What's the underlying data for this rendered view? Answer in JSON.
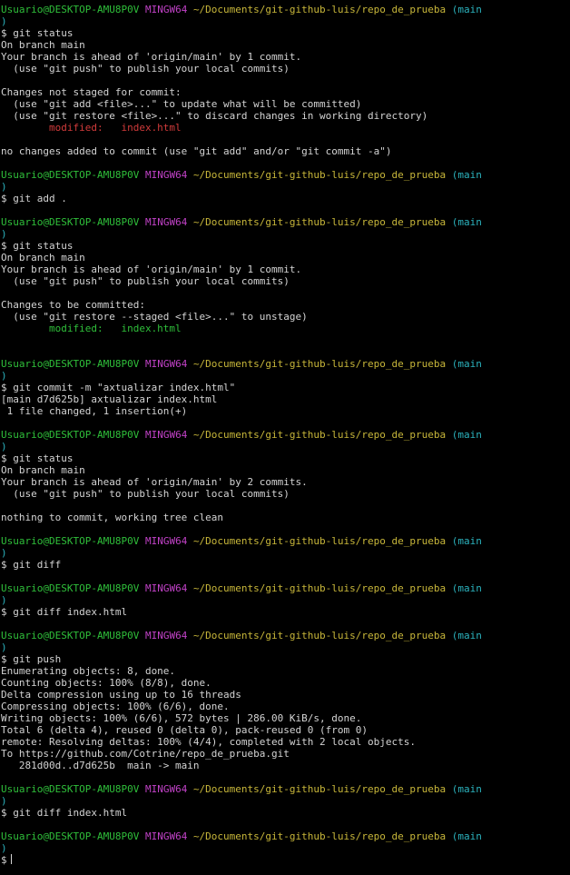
{
  "prompt": {
    "user_host": "Usuario@DESKTOP-AMU8P0V",
    "shell": "MINGW64",
    "path": "~/Documents/git-github-luis/repo_de_prueba",
    "branch_open": "(main",
    "branch_close": ")",
    "symbol": "$"
  },
  "colors": {
    "user_host": "#2fbf3a",
    "shell": "#c242c8",
    "path": "#c8b73a",
    "branch": "#2bb2bd",
    "modified_unstaged": "#d23b3b",
    "modified_staged": "#2fbf3a",
    "text": "#d4d4d4",
    "background": "#000000"
  },
  "blocks": [
    {
      "command": "git status",
      "output": [
        {
          "text": "On branch main"
        },
        {
          "text": "Your branch is ahead of 'origin/main' by 1 commit."
        },
        {
          "text": "  (use \"git push\" to publish your local commits)"
        },
        {
          "text": ""
        },
        {
          "text": "Changes not staged for commit:"
        },
        {
          "text": "  (use \"git add <file>...\" to update what will be committed)"
        },
        {
          "text": "  (use \"git restore <file>...\" to discard changes in working directory)"
        },
        {
          "text": "        modified:   index.html",
          "color": "red"
        },
        {
          "text": ""
        },
        {
          "text": "no changes added to commit (use \"git add\" and/or \"git commit -a\")"
        },
        {
          "text": ""
        }
      ]
    },
    {
      "command": "git add .",
      "output": [
        {
          "text": ""
        }
      ]
    },
    {
      "command": "git status",
      "output": [
        {
          "text": "On branch main"
        },
        {
          "text": "Your branch is ahead of 'origin/main' by 1 commit."
        },
        {
          "text": "  (use \"git push\" to publish your local commits)"
        },
        {
          "text": ""
        },
        {
          "text": "Changes to be committed:"
        },
        {
          "text": "  (use \"git restore --staged <file>...\" to unstage)"
        },
        {
          "text": "        modified:   index.html",
          "color": "green"
        },
        {
          "text": ""
        },
        {
          "text": ""
        }
      ]
    },
    {
      "command": "git commit -m \"axtualizar index.html\"",
      "output": [
        {
          "text": "[main d7d625b] axtualizar index.html"
        },
        {
          "text": " 1 file changed, 1 insertion(+)"
        },
        {
          "text": ""
        }
      ]
    },
    {
      "command": "git status",
      "output": [
        {
          "text": "On branch main"
        },
        {
          "text": "Your branch is ahead of 'origin/main' by 2 commits."
        },
        {
          "text": "  (use \"git push\" to publish your local commits)"
        },
        {
          "text": ""
        },
        {
          "text": "nothing to commit, working tree clean"
        },
        {
          "text": ""
        }
      ]
    },
    {
      "command": "git diff",
      "output": [
        {
          "text": ""
        }
      ]
    },
    {
      "command": "git diff index.html",
      "output": [
        {
          "text": ""
        }
      ]
    },
    {
      "command": "git push",
      "output": [
        {
          "text": "Enumerating objects: 8, done."
        },
        {
          "text": "Counting objects: 100% (8/8), done."
        },
        {
          "text": "Delta compression using up to 16 threads"
        },
        {
          "text": "Compressing objects: 100% (6/6), done."
        },
        {
          "text": "Writing objects: 100% (6/6), 572 bytes | 286.00 KiB/s, done."
        },
        {
          "text": "Total 6 (delta 4), reused 0 (delta 0), pack-reused 0 (from 0)"
        },
        {
          "text": "remote: Resolving deltas: 100% (4/4), completed with 2 local objects."
        },
        {
          "text": "To https://github.com/Cotrine/repo_de_prueba.git"
        },
        {
          "text": "   281d00d..d7d625b  main -> main"
        },
        {
          "text": ""
        }
      ]
    },
    {
      "command": "git diff index.html",
      "output": [
        {
          "text": ""
        }
      ]
    },
    {
      "command": "",
      "output": [],
      "active": true
    }
  ]
}
